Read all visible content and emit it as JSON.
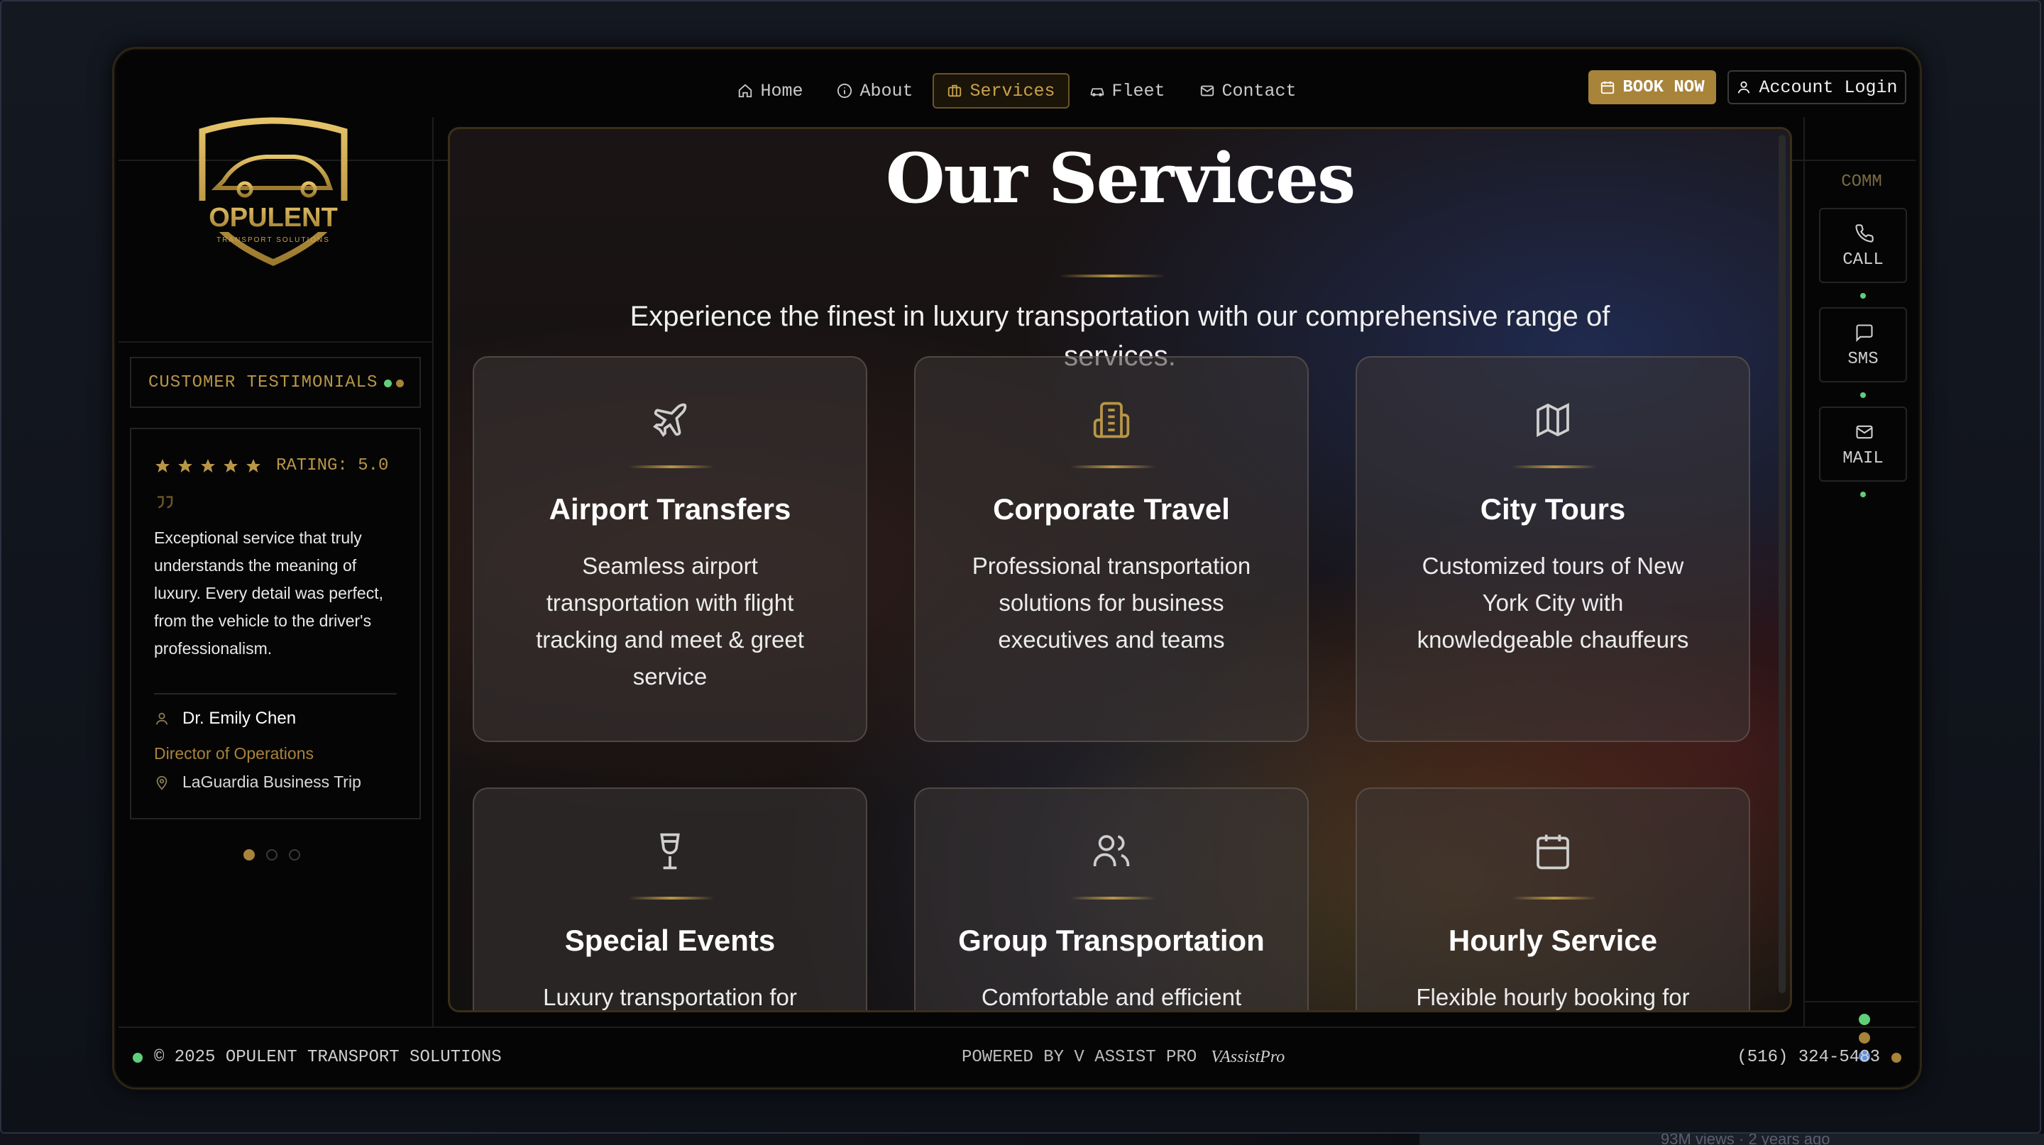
{
  "nav": {
    "items": [
      {
        "label": "Home",
        "icon": "home-icon"
      },
      {
        "label": "About",
        "icon": "info-icon"
      },
      {
        "label": "Services",
        "icon": "briefcase-icon",
        "active": true
      },
      {
        "label": "Fleet",
        "icon": "car-icon"
      },
      {
        "label": "Contact",
        "icon": "mail-icon"
      }
    ],
    "book_label": "BOOK NOW",
    "login_label": "Account Login"
  },
  "brand": {
    "name": "OPULENT",
    "tagline": "TRANSPORT SOLUTIONS"
  },
  "testimonials": {
    "header": "CUSTOMER TESTIMONIALS",
    "rating_label": "RATING: 5.0",
    "stars": 5,
    "quote": "Exceptional service that truly understands the meaning of luxury. Every detail was perfect, from the vehicle to the driver's professionalism.",
    "author": "Dr. Emily Chen",
    "role": "Director of Operations",
    "trip": "LaGuardia Business Trip",
    "pages": 3,
    "current_page": 1
  },
  "main": {
    "title": "Our Services",
    "subtitle": "Experience the finest in luxury transportation with our comprehensive range of services.",
    "services": [
      {
        "title": "Airport Transfers",
        "desc": "Seamless airport transportation with flight tracking and meet & greet service",
        "icon": "plane-icon"
      },
      {
        "title": "Corporate Travel",
        "desc": "Professional transportation solutions for business executives and teams",
        "icon": "building-icon"
      },
      {
        "title": "City Tours",
        "desc": "Customized tours of New York City with knowledgeable chauffeurs",
        "icon": "map-icon"
      },
      {
        "title": "Special Events",
        "desc": "Luxury transportation for",
        "icon": "wine-glass-icon"
      },
      {
        "title": "Group Transportation",
        "desc": "Comfortable and efficient",
        "icon": "users-icon"
      },
      {
        "title": "Hourly Service",
        "desc": "Flexible hourly booking for",
        "icon": "calendar-icon"
      }
    ]
  },
  "comm": {
    "title": "COMM",
    "buttons": [
      {
        "label": "CALL",
        "icon": "phone-icon"
      },
      {
        "label": "SMS",
        "icon": "message-icon"
      },
      {
        "label": "MAIL",
        "icon": "mail-icon"
      }
    ]
  },
  "footer": {
    "copyright": "© 2025 OPULENT TRANSPORT SOLUTIONS",
    "powered": "POWERED BY V ASSIST PRO",
    "vlogo": "VAssistPro",
    "phone": "(516) 324-5483"
  },
  "background_strip": "93M views · 2 years ago",
  "colors": {
    "gold": "#b99646",
    "gold_button": "#a8833a",
    "status_green": "#5fcf7a",
    "status_blue": "#5b8fe0"
  }
}
